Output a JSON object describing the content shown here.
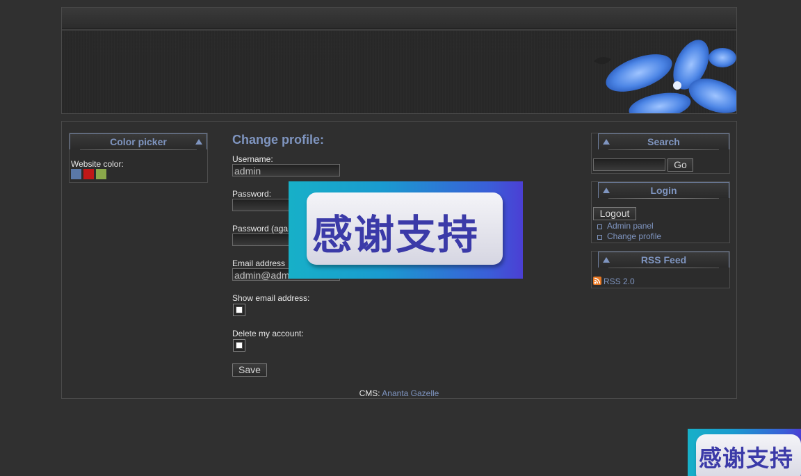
{
  "sidebar_left": {
    "color_picker": {
      "title": "Color picker",
      "label": "Website color:",
      "swatches": [
        "#5a78a8",
        "#c01818",
        "#8aa84a"
      ]
    }
  },
  "form": {
    "title": "Change profile:",
    "username_label": "Username:",
    "username_value": "admin",
    "password_label": "Password:",
    "password_again_label": "Password (aga",
    "email_label": "Email address",
    "email_value": "admin@adm",
    "show_email_label": "Show email address:",
    "delete_account_label": "Delete my account:",
    "save_label": "Save"
  },
  "sidebar_right": {
    "search": {
      "title": "Search",
      "go_label": "Go"
    },
    "login": {
      "title": "Login",
      "logout_label": "Logout",
      "links": [
        "Admin panel",
        "Change profile"
      ]
    },
    "rss": {
      "title": "RSS Feed",
      "link": "RSS 2.0"
    }
  },
  "footer": {
    "prefix": "CMS:",
    "link": "Ananta Gazelle"
  },
  "overlay": {
    "text": "感谢支持"
  },
  "colors": {
    "accent": "#7f95c0",
    "background": "#303030"
  }
}
